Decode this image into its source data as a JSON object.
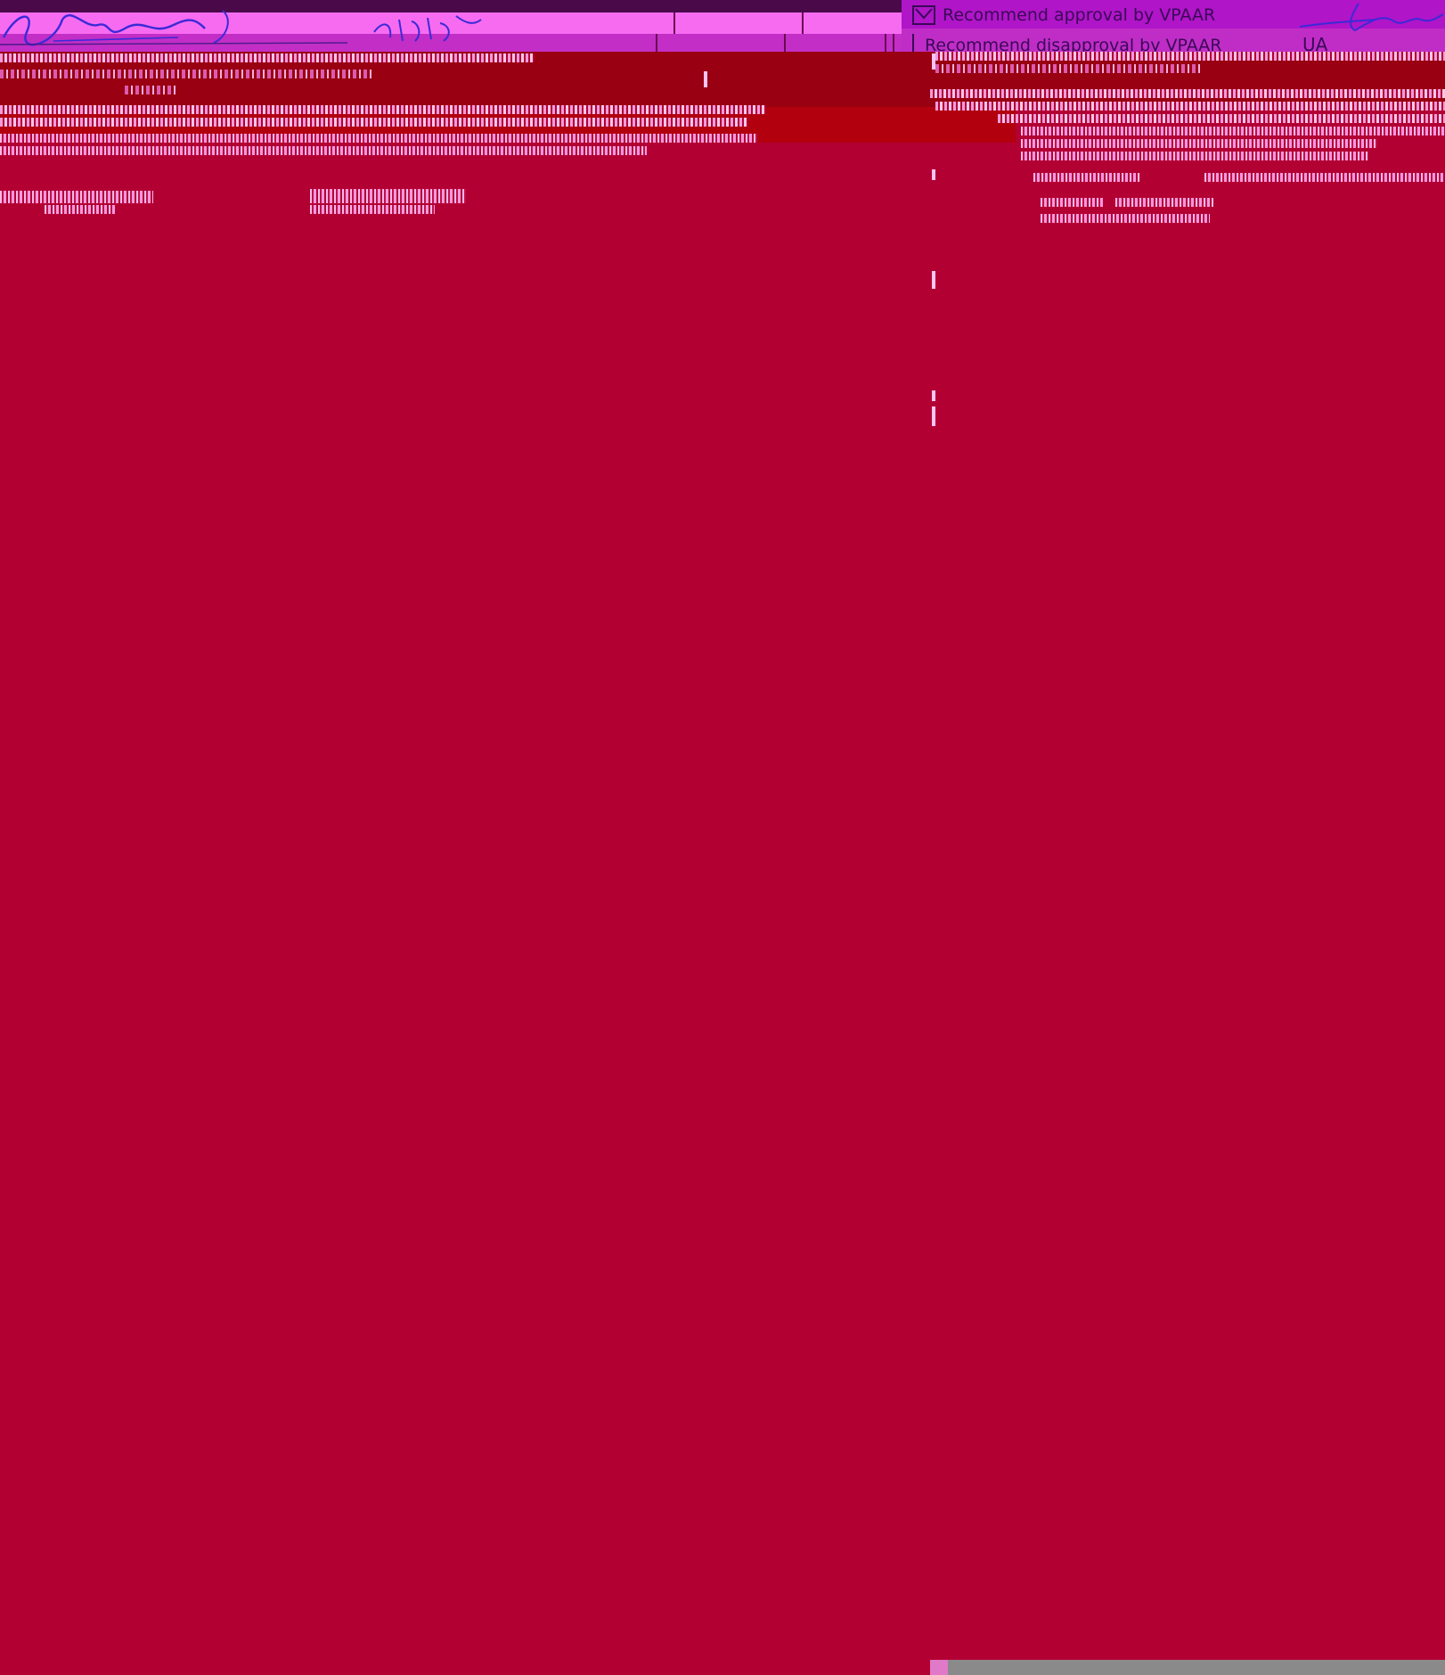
{
  "approval": {
    "approve_label": "Recommend approval by VPAAR",
    "disapprove_label": "Recommend disapproval by VPAAR",
    "date_label": "UA"
  },
  "colors": {
    "background": "#b30033",
    "header_band": "#990011",
    "signature_strip": "#f66bf0",
    "vpaar_panel": "#b015c8",
    "ink": "#3a0858"
  },
  "icons": {
    "approve_checkbox": "checked-box-icon",
    "disapprove_checkbox": "empty-box-icon"
  }
}
